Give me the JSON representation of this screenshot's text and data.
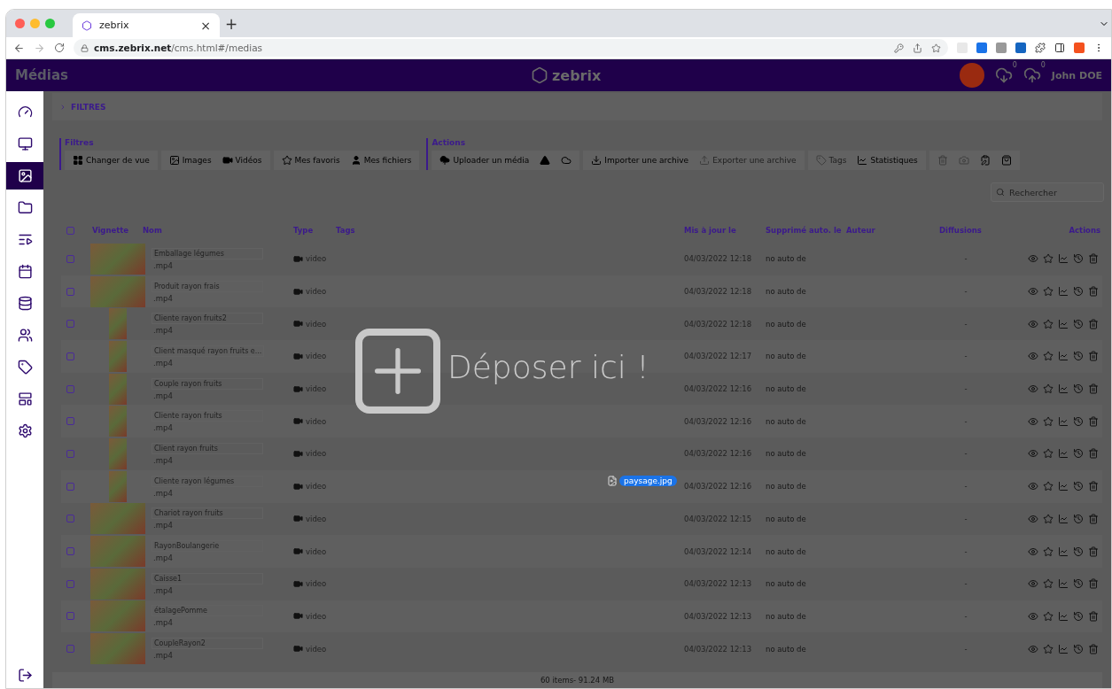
{
  "browser": {
    "tab": {
      "title": "zebrix",
      "close": "×",
      "new": "+"
    },
    "url": "**cms.zebrix.net**/cms.html#/medias"
  },
  "header": {
    "title": "Médias",
    "logo": "zebrix",
    "downloads": "0",
    "uploads": "0",
    "user": "John DOE"
  },
  "sidebar": {
    "items": [
      {
        "kind": "dashboard",
        "selected": false
      },
      {
        "kind": "screen",
        "selected": false
      },
      {
        "kind": "images",
        "selected": true
      },
      {
        "kind": "folder",
        "selected": false
      },
      {
        "kind": "playlist",
        "selected": false
      },
      {
        "kind": "calendar",
        "selected": false
      },
      {
        "kind": "database",
        "selected": false
      },
      {
        "kind": "groups",
        "selected": false
      },
      {
        "kind": "tag",
        "selected": false
      },
      {
        "kind": "layout",
        "selected": false
      },
      {
        "kind": "settings",
        "selected": false
      }
    ]
  },
  "filter_toggle": "FILTRES",
  "toolbar": [
    {
      "title": "Filtres",
      "groups": [
        [
          {
            "kind": "grid",
            "label": "Changer de vue",
            "disabled": false
          }
        ],
        [
          {
            "kind": "image",
            "label": "Images",
            "disabled": false
          },
          {
            "kind": "video",
            "label": "Vidéos",
            "disabled": false
          }
        ],
        [
          {
            "kind": "star",
            "label": "Mes favoris",
            "disabled": false
          },
          {
            "kind": "user",
            "label": "Mes fichiers",
            "disabled": false
          }
        ]
      ]
    },
    {
      "title": "Actions",
      "groups": [
        [
          {
            "kind": "upload",
            "label": "Uploader un média",
            "disabled": false
          },
          {
            "kind": "drive",
            "disabled": false
          },
          {
            "kind": "cloud",
            "disabled": false
          }
        ],
        [
          {
            "kind": "import",
            "label": "Importer une archive",
            "disabled": false
          },
          {
            "kind": "export",
            "label": "Exporter une archive",
            "disabled": true
          }
        ],
        [
          {
            "kind": "tag",
            "label": "Tags",
            "disabled": true
          },
          {
            "kind": "chart",
            "label": "Statistiques",
            "disabled": false
          }
        ],
        [
          {
            "kind": "trash",
            "disabled": true
          },
          {
            "kind": "camera",
            "disabled": true
          },
          {
            "kind": "clipboard",
            "disabled": false
          },
          {
            "kind": "bag",
            "disabled": false
          }
        ]
      ]
    }
  ],
  "search": {
    "placeholder": "Rechercher"
  },
  "table": {
    "select_all": false,
    "columns": [
      "Vignette",
      "Nom",
      "Type",
      "Tags",
      "Mis à jour le",
      "Supprimé auto. le",
      "Auteur",
      "Diffusions",
      "Actions"
    ],
    "rows": [
      {
        "checked": false,
        "kind": "landscape",
        "name": "Emballage légumes",
        "ext": ".mp4",
        "type": "video",
        "updated": "04/03/2022 12:18",
        "auto_delete": "no auto de",
        "diffusions": "-"
      },
      {
        "checked": false,
        "kind": "landscape",
        "name": "Produit rayon frais",
        "ext": ".mp4",
        "type": "video",
        "updated": "04/03/2022 12:18",
        "auto_delete": "no auto de",
        "diffusions": "-"
      },
      {
        "checked": false,
        "kind": "portrait",
        "name": "Cliente rayon fruits2",
        "ext": ".mp4",
        "type": "video",
        "updated": "04/03/2022 12:18",
        "auto_delete": "no auto de",
        "diffusions": "-"
      },
      {
        "checked": false,
        "kind": "portrait",
        "name": "Client masqué rayon fruits e...",
        "ext": ".mp4",
        "type": "video",
        "updated": "04/03/2022 12:17",
        "auto_delete": "no auto de",
        "diffusions": "-"
      },
      {
        "checked": false,
        "kind": "portrait",
        "name": "Couple rayon fruits",
        "ext": ".mp4",
        "type": "video",
        "updated": "04/03/2022 12:16",
        "auto_delete": "no auto de",
        "diffusions": "-"
      },
      {
        "checked": false,
        "kind": "portrait",
        "name": "Cliente rayon fruits",
        "ext": ".mp4",
        "type": "video",
        "updated": "04/03/2022 12:16",
        "auto_delete": "no auto de",
        "diffusions": "-"
      },
      {
        "checked": false,
        "kind": "portrait",
        "name": "Client rayon fruits",
        "ext": ".mp4",
        "type": "video",
        "updated": "04/03/2022 12:16",
        "auto_delete": "no auto de",
        "diffusions": "-"
      },
      {
        "checked": false,
        "kind": "portrait",
        "name": "Cliente rayon légumes",
        "ext": ".mp4",
        "type": "video",
        "updated": "04/03/2022 12:16",
        "auto_delete": "no auto de",
        "diffusions": "-"
      },
      {
        "checked": false,
        "kind": "landscape",
        "name": "Chariot rayon fruits",
        "ext": ".mp4",
        "type": "video",
        "updated": "04/03/2022 12:15",
        "auto_delete": "no auto de",
        "diffusions": "-"
      },
      {
        "checked": false,
        "kind": "landscape",
        "name": "RayonBoulangerie",
        "ext": ".mp4",
        "type": "video",
        "updated": "04/03/2022 12:14",
        "auto_delete": "no auto de",
        "diffusions": "-"
      },
      {
        "checked": false,
        "kind": "landscape",
        "name": "Caisse1",
        "ext": ".mp4",
        "type": "video",
        "updated": "04/03/2022 12:13",
        "auto_delete": "no auto de",
        "diffusions": "-"
      },
      {
        "checked": false,
        "kind": "landscape",
        "name": "étalagePomme",
        "ext": ".mp4",
        "type": "video",
        "updated": "04/03/2022 12:13",
        "auto_delete": "no auto de",
        "diffusions": "-"
      },
      {
        "checked": false,
        "kind": "landscape",
        "name": "CoupleRayon2",
        "ext": ".mp4",
        "type": "video",
        "updated": "04/03/2022 12:13",
        "auto_delete": "no auto de",
        "diffusions": "-"
      }
    ]
  },
  "footer": "60 items- 91.24 MB",
  "drop_zone": {
    "text": "Déposer ici !",
    "dragged_file": "paysage.jpg"
  }
}
